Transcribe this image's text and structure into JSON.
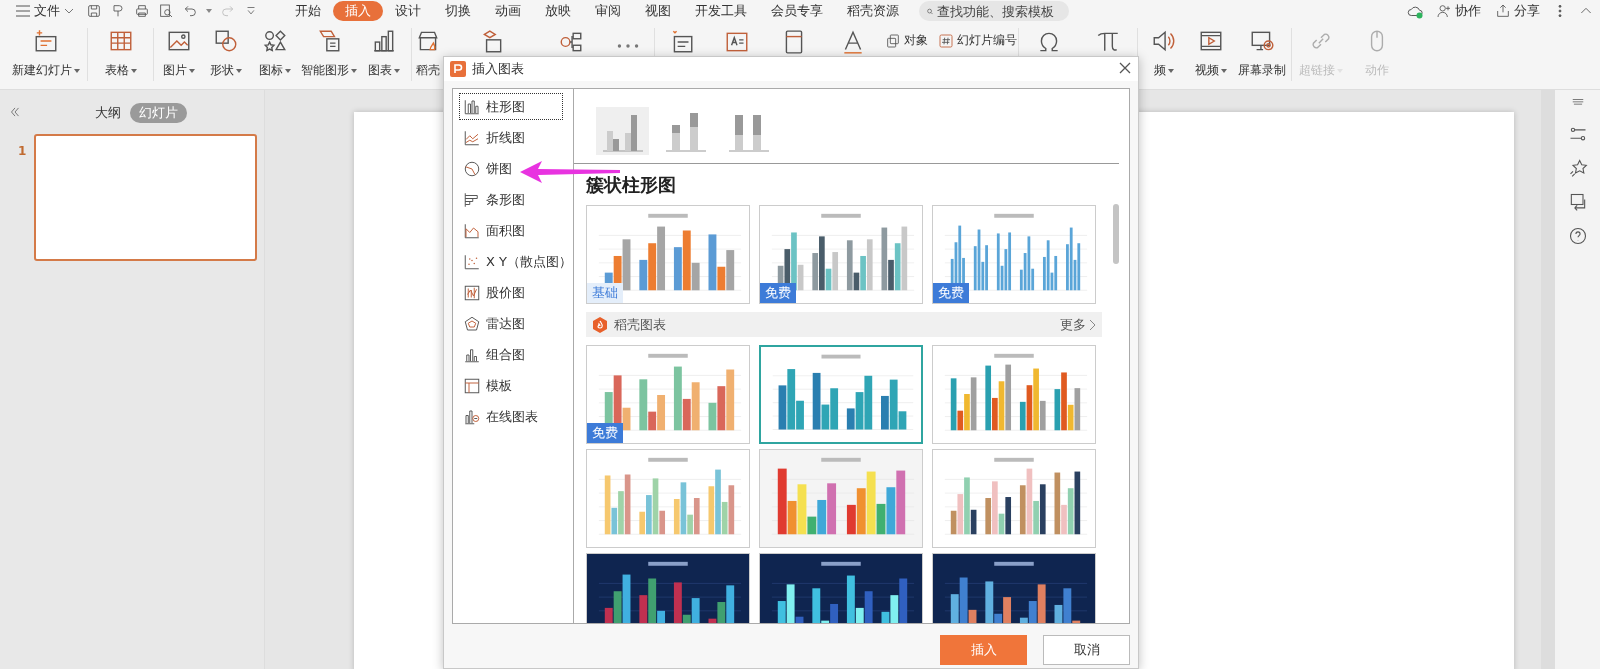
{
  "menu_bar": {
    "file_menu": "文件",
    "tabs": [
      {
        "label": "开始",
        "selected": false
      },
      {
        "label": "插入",
        "selected": true
      },
      {
        "label": "设计",
        "selected": false
      },
      {
        "label": "切换",
        "selected": false
      },
      {
        "label": "动画",
        "selected": false
      },
      {
        "label": "放映",
        "selected": false
      },
      {
        "label": "审阅",
        "selected": false
      },
      {
        "label": "视图",
        "selected": false
      },
      {
        "label": "开发工具",
        "selected": false
      },
      {
        "label": "会员专享",
        "selected": false
      },
      {
        "label": "稻壳资源",
        "selected": false
      }
    ],
    "search": {
      "placeholder": "查找功能、搜索模板"
    },
    "actions": [
      {
        "label": "协作"
      },
      {
        "label": "分享"
      }
    ]
  },
  "ribbon": {
    "groups": [
      {
        "items": [
          {
            "kind": "large",
            "label": "新建幻灯片",
            "dropdown": true,
            "disabled": false
          }
        ]
      },
      {
        "items": [
          {
            "kind": "large",
            "label": "表格",
            "dropdown": true,
            "disabled": false
          }
        ]
      },
      {
        "items": [
          {
            "kind": "large",
            "label": "图片",
            "dropdown": true,
            "disabled": false
          },
          {
            "kind": "large",
            "label": "形状",
            "dropdown": true,
            "disabled": false
          },
          {
            "kind": "large",
            "label": "图标",
            "dropdown": true,
            "disabled": false
          },
          {
            "kind": "large",
            "label": "智能图形",
            "dropdown": true,
            "disabled": false
          },
          {
            "kind": "large",
            "label": "图表",
            "dropdown": true,
            "disabled": false
          }
        ]
      },
      {
        "items": [
          {
            "kind": "large",
            "label": "稻壳",
            "dropdown": false,
            "disabled": false
          },
          {
            "kind": "icon"
          },
          {
            "kind": "icon"
          },
          {
            "kind": "icon"
          }
        ]
      },
      {
        "items": [
          {
            "kind": "icon"
          },
          {
            "kind": "icon"
          },
          {
            "kind": "icon"
          },
          {
            "kind": "icon"
          },
          {
            "kind": "small_stack",
            "buttons": [
              {
                "label": "对象"
              },
              {
                "label": "幻灯片编号"
              }
            ]
          }
        ]
      },
      {
        "items": [
          {
            "kind": "icon"
          },
          {
            "kind": "icon"
          }
        ]
      },
      {
        "items": [
          {
            "kind": "large",
            "label": "频",
            "dropdown": true,
            "disabled": false
          },
          {
            "kind": "large",
            "label": "视频",
            "dropdown": true,
            "disabled": false
          },
          {
            "kind": "large",
            "label": "屏幕录制",
            "dropdown": false,
            "disabled": false
          }
        ]
      },
      {
        "items": [
          {
            "kind": "large",
            "label": "超链接",
            "dropdown": true,
            "disabled": true
          },
          {
            "kind": "large",
            "label": "动作",
            "dropdown": false,
            "disabled": true
          }
        ]
      }
    ]
  },
  "slides_panel": {
    "tabs": [
      {
        "label": "大纲",
        "selected": false
      },
      {
        "label": "幻灯片",
        "selected": true
      }
    ],
    "slides": [
      {
        "number": "1",
        "selected": true
      }
    ]
  },
  "dialog": {
    "title": "插入图表",
    "categories": [
      {
        "label": "柱形图",
        "selected": true
      },
      {
        "label": "折线图",
        "selected": false
      },
      {
        "label": "饼图",
        "selected": false
      },
      {
        "label": "条形图",
        "selected": false
      },
      {
        "label": "面积图",
        "selected": false
      },
      {
        "label": "X Y（散点图）",
        "selected": false
      },
      {
        "label": "股价图",
        "selected": false
      },
      {
        "label": "雷达图",
        "selected": false
      },
      {
        "label": "组合图",
        "selected": false
      },
      {
        "label": "模板",
        "selected": false
      },
      {
        "label": "在线图表",
        "selected": false
      }
    ],
    "subtypes": [
      {
        "kind": "clustered",
        "selected": true
      },
      {
        "kind": "stacked",
        "selected": false
      },
      {
        "kind": "percent",
        "selected": false
      }
    ],
    "heading": "簇状柱形图",
    "basic_templates": [
      {
        "kind": "light",
        "selected": false,
        "badge": {
          "text": "基础",
          "kind": "basic"
        }
      },
      {
        "kind": "light",
        "selected": false,
        "badge": {
          "text": "免费",
          "kind": "free"
        }
      },
      {
        "kind": "light",
        "selected": false,
        "badge": {
          "text": "免费",
          "kind": "free"
        }
      }
    ],
    "section": {
      "title": "稻壳图表",
      "more": "更多"
    },
    "templates": [
      {
        "kind": "light",
        "selected": false,
        "badge": {
          "text": "免费",
          "kind": "free"
        }
      },
      {
        "kind": "light",
        "selected": true
      },
      {
        "kind": "light",
        "selected": false
      },
      {
        "kind": "light",
        "selected": false
      },
      {
        "kind": "gray",
        "selected": false
      },
      {
        "kind": "light",
        "selected": false
      },
      {
        "kind": "dark",
        "selected": false
      },
      {
        "kind": "dark",
        "selected": false
      },
      {
        "kind": "dark",
        "selected": false
      }
    ],
    "buttons": [
      {
        "label": "插入",
        "kind": "primary"
      },
      {
        "label": "取消",
        "kind": "secondary"
      }
    ]
  }
}
